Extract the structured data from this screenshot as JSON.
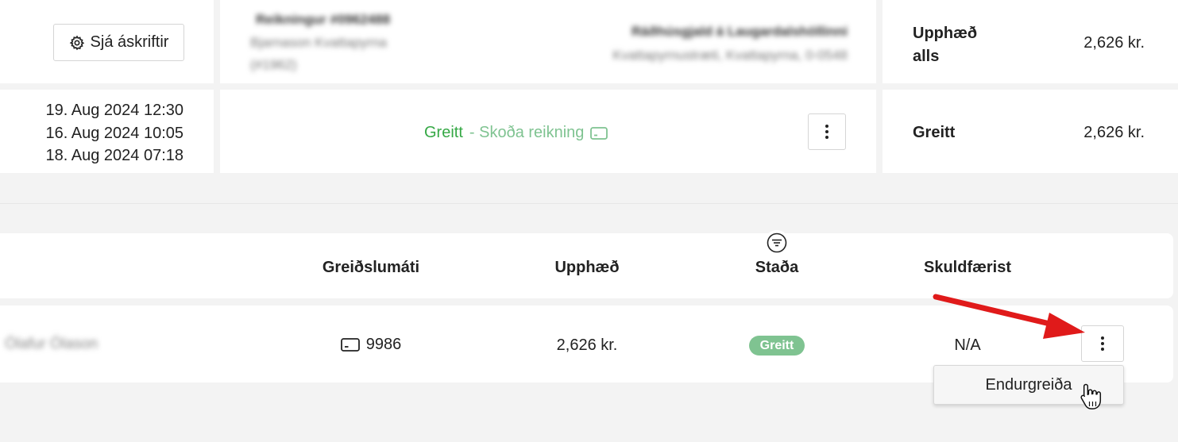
{
  "subscription": {
    "view_subscriptions_label": "Sjá áskriftir",
    "blurred_title": "Reikningur #0962488",
    "blurred_name": "Bjarnason Kvattapyrna",
    "blurred_id": "(#1962)",
    "blurred_location": "Ráðhúsgjald á Laugardalshöllinni",
    "blurred_address": "Kvattapyrnustræti, Kvattapyrna, 0-0548",
    "total_label": "Upphæð alls",
    "total_label_line1": "Upphæð",
    "total_label_line2": "alls",
    "total_amount": "2,626 kr."
  },
  "payment_summary": {
    "dates": [
      "19. Aug 2024 12:30",
      "16. Aug 2024 10:05",
      "18. Aug 2024 07:18"
    ],
    "status_paid": "Greitt",
    "view_invoice_label": "- Skoða reikning",
    "paid_label": "Greitt",
    "paid_amount": "2,626 kr."
  },
  "transactions_table": {
    "headers": {
      "payment_method": "Greiðslumáti",
      "amount": "Upphæð",
      "status": "Staða",
      "debited": "Skuldfærist"
    },
    "rows": [
      {
        "name_blurred": "Ólafur Ólason",
        "card_last4": "9986",
        "amount": "2,626 kr.",
        "status": "Greitt",
        "debited": "N/A"
      }
    ],
    "row_menu": {
      "refund_label": "Endurgreiða"
    }
  },
  "colors": {
    "paid_green": "#35a845",
    "paid_badge": "#7fc391",
    "invoice_green": "#7fc391",
    "annotation_arrow": "#e01a1a"
  },
  "icons": {
    "settings": "gear-icon",
    "card": "credit-card-icon",
    "filter": "filter-icon",
    "more": "kebab-menu-icon",
    "cursor": "hand-pointer-icon",
    "annotation": "red-arrow"
  }
}
